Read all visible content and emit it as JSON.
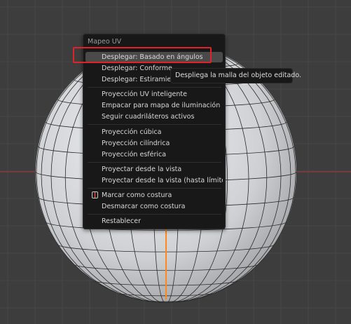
{
  "menu": {
    "title": "Mapeo UV",
    "items": [
      {
        "id": "unwrap-angle-based",
        "label": "Desplegar: Basado en ángulos"
      },
      {
        "id": "unwrap-conformal",
        "label": "Desplegar: Conforme"
      },
      {
        "id": "unwrap-minimum-stretch",
        "label": "Desplegar: Estiramient"
      },
      {
        "id": "smart-uv-project",
        "label": "Proyección UV inteligente"
      },
      {
        "id": "lightmap-pack",
        "label": "Empacar para mapa de iluminación"
      },
      {
        "id": "follow-active-quads",
        "label": "Seguir cuadriláteros activos"
      },
      {
        "id": "cube-projection",
        "label": "Proyección cúbica"
      },
      {
        "id": "cylinder-projection",
        "label": "Proyección cilíndrica"
      },
      {
        "id": "sphere-projection",
        "label": "Proyección esférica"
      },
      {
        "id": "project-from-view",
        "label": "Proyectar desde la vista"
      },
      {
        "id": "project-from-view-bounds",
        "label": "Proyectar desde la vista (hasta límites)"
      },
      {
        "id": "mark-seam",
        "label": "Marcar como costura",
        "icon": "seam-icon"
      },
      {
        "id": "clear-seam",
        "label": "Desmarcar como costura"
      },
      {
        "id": "reset",
        "label": "Restablecer"
      }
    ]
  },
  "tooltip": "Despliega la malla del objeto editado.",
  "colors": {
    "background": "#3d3d3d",
    "menu_background": "#181818",
    "hover": "#4a4a4a",
    "highlight_box": "#e0222a",
    "x_axis": "#8e3a3e",
    "seam": "#ff8a18"
  }
}
